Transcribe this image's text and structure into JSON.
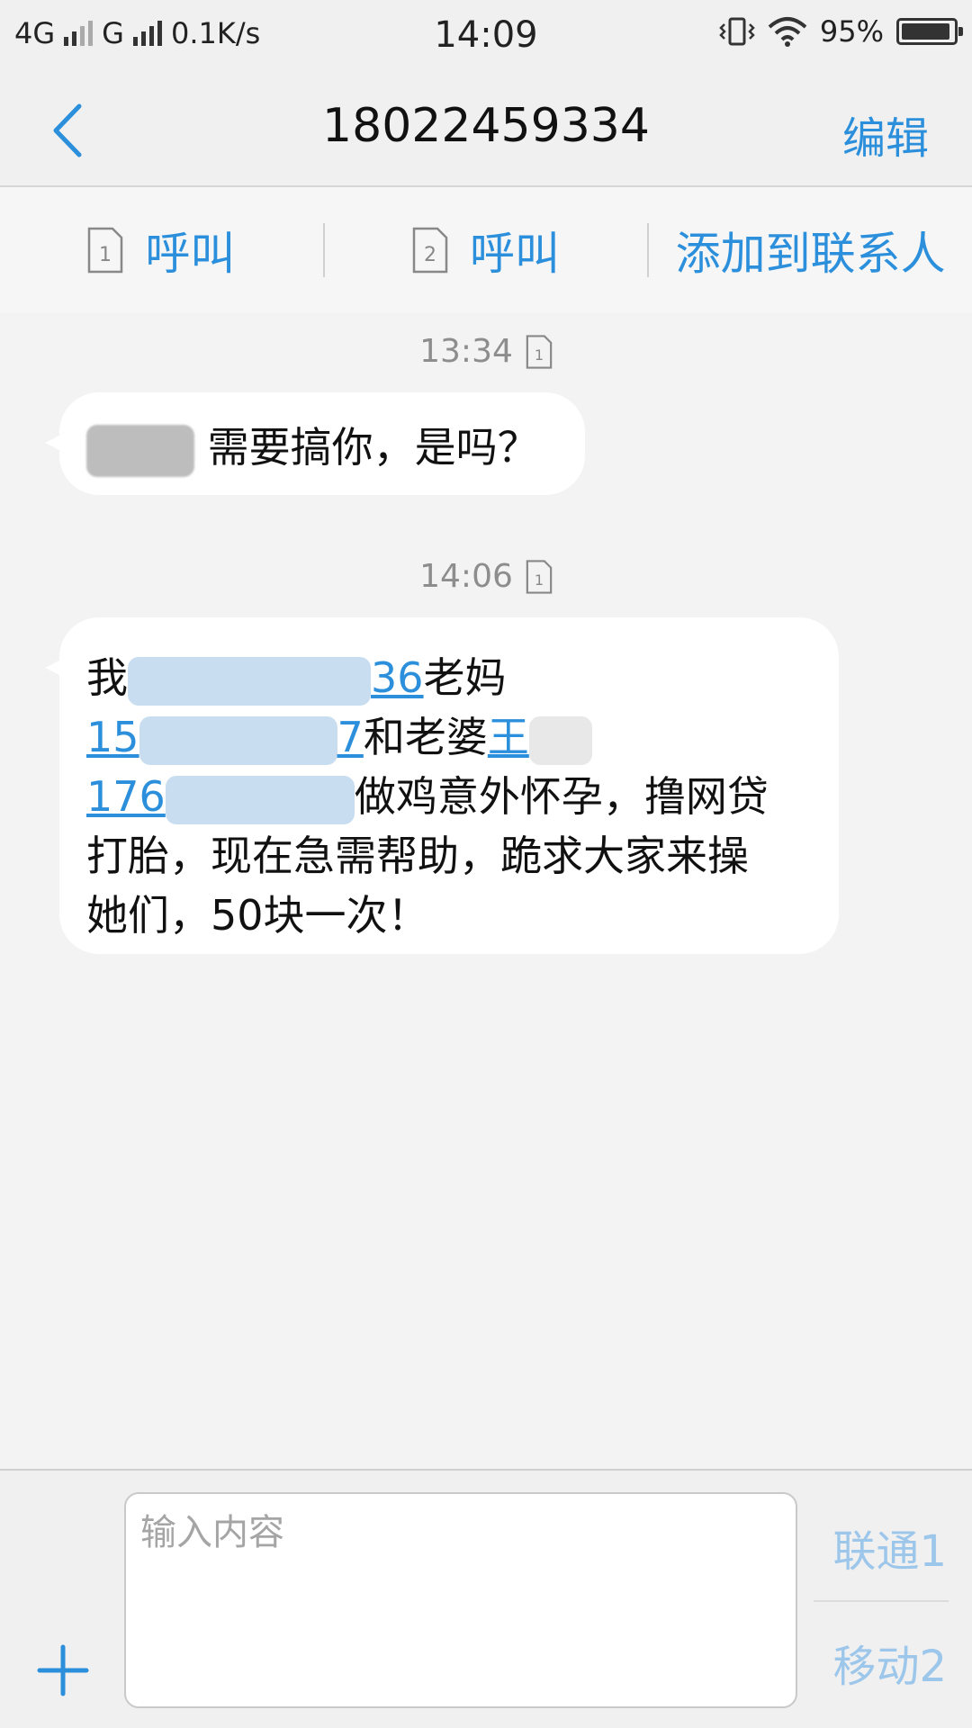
{
  "status_bar": {
    "network1": "4G",
    "network2": "G",
    "speed": "0.1K/s",
    "time": "14:09",
    "battery": "95%",
    "battery_level": 0.95
  },
  "header": {
    "title": "18022459334",
    "edit_label": "编辑"
  },
  "actions": {
    "call1_label": "呼叫",
    "call2_label": "呼叫",
    "add_contact_label": "添加到联系人",
    "sim1": "1",
    "sim2": "2"
  },
  "messages": [
    {
      "time": "13:34",
      "sim": "1",
      "text_after": "需要搞你，是吗？"
    },
    {
      "time": "14:06",
      "sim": "1",
      "line1_start": "我",
      "line1_link_end": "36",
      "line1_end": "老妈",
      "line2_link_start": "15",
      "line2_link_end": "7",
      "line2_mid": "和老婆",
      "line2_link2": "王",
      "line3_link_start": "176",
      "line3_end": "做鸡意外怀孕，撸网贷",
      "line4": "打胎，现在急需帮助，跪求大家来操",
      "line5": "她们，50块一次！"
    }
  ],
  "composer": {
    "placeholder": "输入内容",
    "send1_label": "联通1",
    "send2_label": "移动2"
  }
}
